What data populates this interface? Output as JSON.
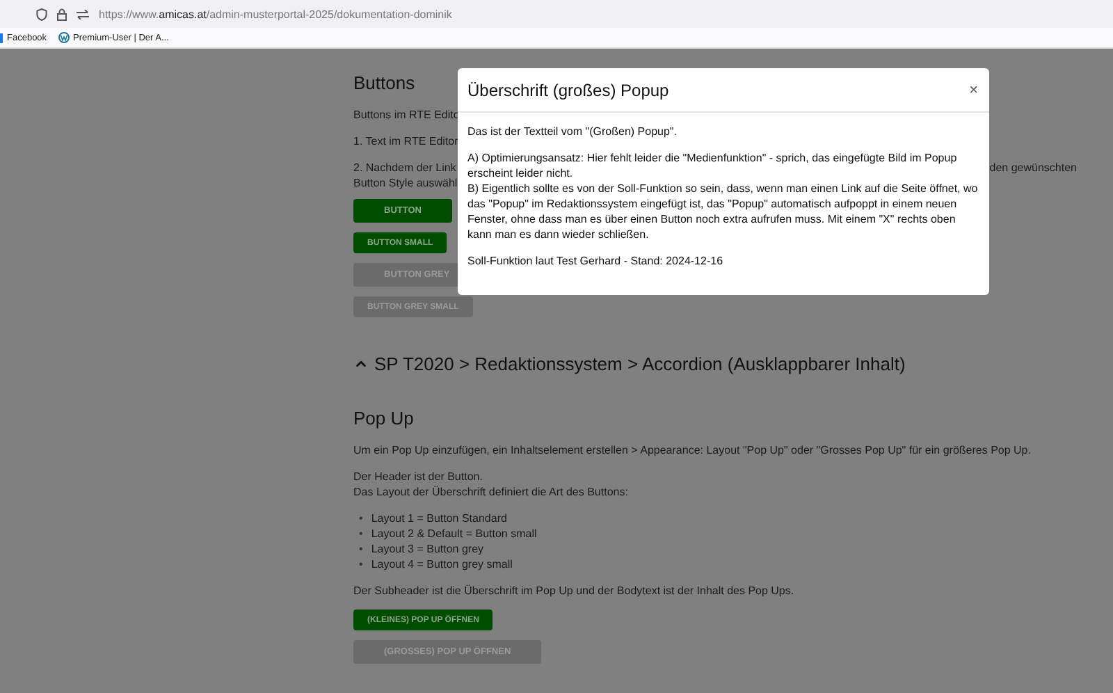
{
  "browser": {
    "url": "https://www.**amicas.at**/admin-musterportal-2025/dokumentation-dominik",
    "bookmarks": [
      {
        "label": "Facebook",
        "kind": "facebook"
      },
      {
        "label": "Premium-User | Der A...",
        "kind": "wordpress"
      }
    ]
  },
  "buttons_section": {
    "heading": "Buttons",
    "intro": "Buttons im RTE Edito",
    "step_1": "1. Text im RTE Editor",
    "step_2_left": [
      "2. Nachdem der Link",
      "Button Style auswähl"
    ],
    "step_2_right": "den gewünschten",
    "buttons": [
      {
        "label": "BUTTON",
        "kind": "primary",
        "small": false
      },
      {
        "label": "BUTTON SMALL",
        "kind": "primary",
        "small": true
      },
      {
        "label": "BUTTON GREY",
        "kind": "grey",
        "small": false
      },
      {
        "label": "BUTTON GREY SMALL",
        "kind": "grey",
        "small": true
      }
    ]
  },
  "accordion": {
    "title": "SP T2020 > Redaktionssystem > Accordion (Ausklappbarer Inhalt)",
    "expanded": true
  },
  "popup_section": {
    "heading": "Pop Up",
    "intro": "Um ein Pop Up einzufügen, ein Inhaltselement erstellen > Appearance: Layout \"Pop Up\" oder \"Grosses Pop Up\" für ein größeres Pop Up.",
    "header_note": [
      "Der Header ist der Button.",
      "Das Layout der Überschrift definiert die Art des Buttons:"
    ],
    "layouts": [
      {
        "marker": "•",
        "text": "Layout 1 = Button Standard"
      },
      {
        "marker": "•",
        "text": "Layout 2 & Default = Button small"
      },
      {
        "marker": "•",
        "text": "Layout 3 = Button grey"
      },
      {
        "marker": "•",
        "text": "Layout 4 = Button grey small"
      }
    ],
    "subheader_note": "Der Subheader ist die Überschrift im Pop Up und der Bodytext ist der Inhalt des Pop Ups.",
    "buttons": [
      {
        "label": "(KLEINES) POP UP ÖFFNEN",
        "kind": "primary",
        "small": true
      },
      {
        "label": "(GROSSES) POP UP ÖFFNEN",
        "kind": "grey",
        "small": false
      }
    ]
  },
  "modal": {
    "title": "Überschrift (großes) Popup",
    "close": "×",
    "paragraphs": [
      "Das ist der Textteil vom \"(Großen) Popup\".",
      "A) Optimierungsansatz: Hier fehlt leider die \"Medienfunktion\" - sprich, das eingefügte Bild im Popup erscheint leider nicht.\nB) Eigentlich sollte es von der Soll-Funktion so sein, dass, wenn man einen Link auf die Seite öffnet, wo das \"Popup\" im Redaktionssystem eingefügt ist, das \"Popup\" automatisch aufpoppt in einem neuen Fenster, ohne dass man es über einen Button noch extra aufrufen muss. Mit einem \"X\" rechts oben kann man es dann wieder schließen.",
      "Soll-Funktion laut Test Gerhard - Stand: 2024-12-16"
    ]
  }
}
